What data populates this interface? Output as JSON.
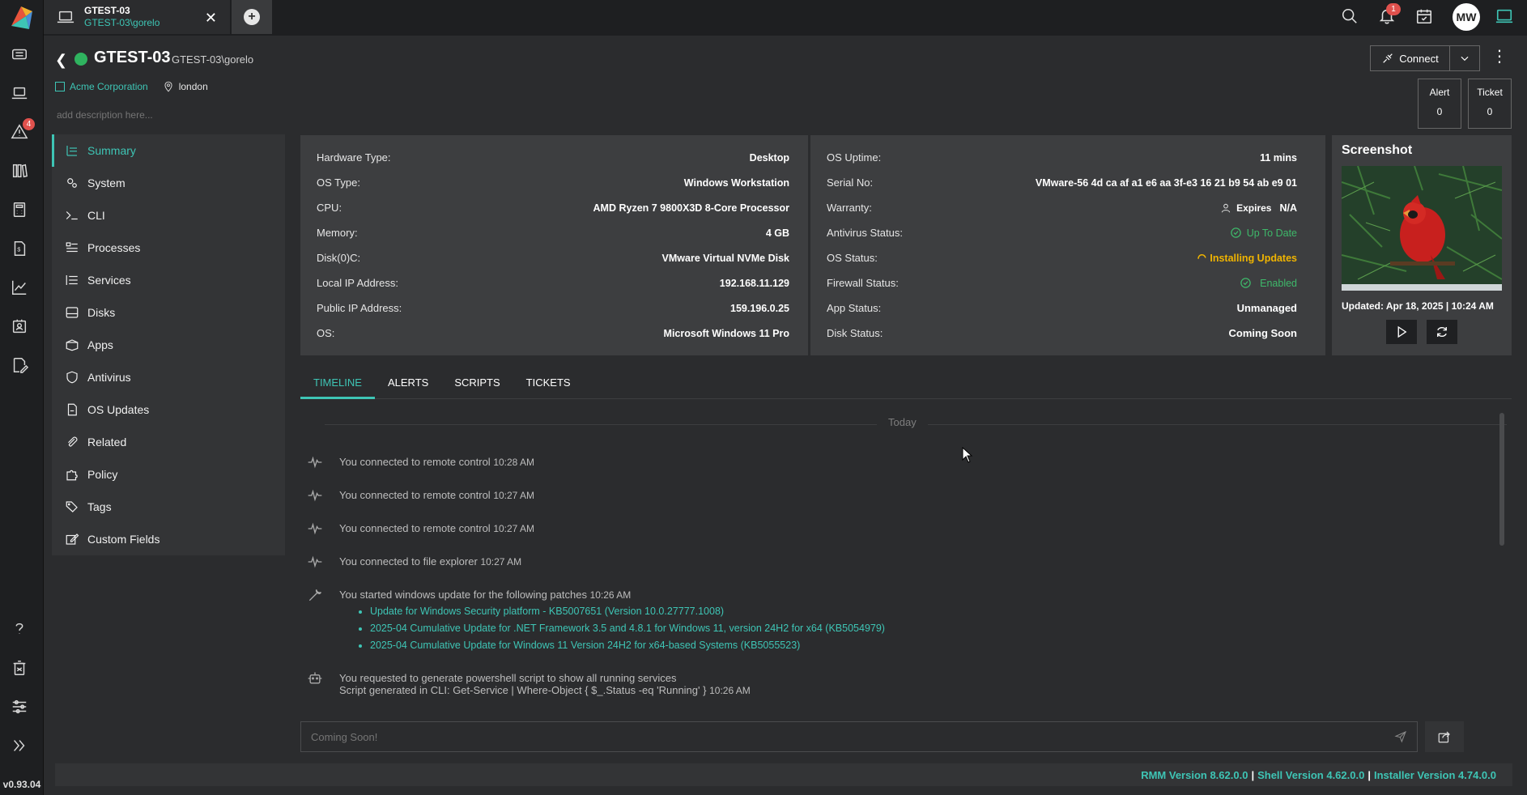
{
  "app": {
    "version": "v0.93.04"
  },
  "rail": {
    "alert_badge": "4"
  },
  "topbar": {
    "tab_title": "GTEST-03",
    "tab_subtitle": "GTEST-03\\gorelo",
    "notification_badge": "1",
    "avatar_initials": "MW"
  },
  "device": {
    "name": "GTEST-03",
    "user": "GTEST-03\\gorelo",
    "organization": "Acme Corporation",
    "location": "london",
    "description_placeholder": "add description here...",
    "status_color": "#2fb35f"
  },
  "actions": {
    "connect_label": "Connect",
    "alert_label": "Alert",
    "alert_count": "0",
    "ticket_label": "Ticket",
    "ticket_count": "0"
  },
  "nav": {
    "items": [
      {
        "label": "Summary",
        "icon": "list-icon"
      },
      {
        "label": "System",
        "icon": "gears-icon"
      },
      {
        "label": "CLI",
        "icon": "terminal-icon"
      },
      {
        "label": "Processes",
        "icon": "processes-icon"
      },
      {
        "label": "Services",
        "icon": "services-icon"
      },
      {
        "label": "Disks",
        "icon": "disk-icon"
      },
      {
        "label": "Apps",
        "icon": "box-icon"
      },
      {
        "label": "Antivirus",
        "icon": "shield-icon"
      },
      {
        "label": "OS Updates",
        "icon": "os-updates-icon"
      },
      {
        "label": "Related",
        "icon": "paperclip-icon"
      },
      {
        "label": "Policy",
        "icon": "puzzle-icon"
      },
      {
        "label": "Tags",
        "icon": "tags-icon"
      },
      {
        "label": "Custom Fields",
        "icon": "edit-icon"
      }
    ]
  },
  "info": {
    "left": [
      {
        "k": "Hardware Type:",
        "v": "Desktop"
      },
      {
        "k": "OS Type:",
        "v": "Windows Workstation"
      },
      {
        "k": "CPU:",
        "v": "AMD Ryzen 7 9800X3D 8-Core Processor"
      },
      {
        "k": "Memory:",
        "v": "4 GB"
      },
      {
        "k": "Disk(0)C:",
        "v": "VMware Virtual NVMe Disk"
      },
      {
        "k": "Local IP Address:",
        "v": "192.168.11.129"
      },
      {
        "k": "Public IP Address:",
        "v": "159.196.0.25"
      },
      {
        "k": "OS:",
        "v": "Microsoft Windows 11 Pro"
      }
    ],
    "right": {
      "uptime_k": "OS Uptime:",
      "uptime_v": "11 mins",
      "serial_k": "Serial No:",
      "serial_v": "VMware-56 4d ca af a1 e6 aa 3f-e3 16 21 b9 54 ab e9 01",
      "warranty_k": "Warranty:",
      "warranty_expires": "Expires",
      "warranty_v": "N/A",
      "av_k": "Antivirus Status:",
      "av_v": "Up To Date",
      "os_status_k": "OS Status:",
      "os_status_v": "Installing Updates",
      "fw_k": "Firewall Status:",
      "fw_v": "Enabled",
      "app_k": "App Status:",
      "app_v": "Unmanaged",
      "disk_k": "Disk Status:",
      "disk_v": "Coming Soon"
    },
    "colors": {
      "green": "#3eb86a",
      "orange": "#f0b400",
      "accent": "#3ec5b5"
    }
  },
  "screenshot": {
    "title": "Screenshot",
    "updated": "Updated: Apr 18, 2025 | 10:24 AM"
  },
  "tabs": [
    "TIMELINE",
    "ALERTS",
    "SCRIPTS",
    "TICKETS"
  ],
  "timeline": {
    "day_label": "Today",
    "events": [
      {
        "text": "You connected to remote control",
        "time": "10:28 AM",
        "icon": "pulse-icon"
      },
      {
        "text": "You connected to remote control",
        "time": "10:27 AM",
        "icon": "pulse-icon"
      },
      {
        "text": "You connected to remote control",
        "time": "10:27 AM",
        "icon": "pulse-icon"
      },
      {
        "text": "You connected to file explorer",
        "time": "10:27 AM",
        "icon": "pulse-icon"
      }
    ],
    "update_event": {
      "text": "You started windows update for the following patches",
      "time": "10:26 AM"
    },
    "patches": [
      "Update for Windows Security platform - KB5007651 (Version 10.0.27777.1008)",
      "2025-04 Cumulative Update for .NET Framework 3.5 and 4.8.1 for Windows 11, version 24H2 for x64 (KB5054979)",
      "2025-04 Cumulative Update for Windows 11 Version 24H2 for x64-based Systems (KB5055523)"
    ],
    "script_event": {
      "text": "You requested to generate powershell script to show all running services",
      "line2": "Script generated in CLI: Get-Service | Where-Object { $_.Status -eq 'Running' }",
      "time": "10:26 AM"
    }
  },
  "compose": {
    "placeholder": "Coming Soon!"
  },
  "footer": {
    "rmm": "RMM Version 8.62.0.0",
    "shell": "Shell Version 4.62.0.0",
    "installer": "Installer Version 4.74.0.0"
  }
}
